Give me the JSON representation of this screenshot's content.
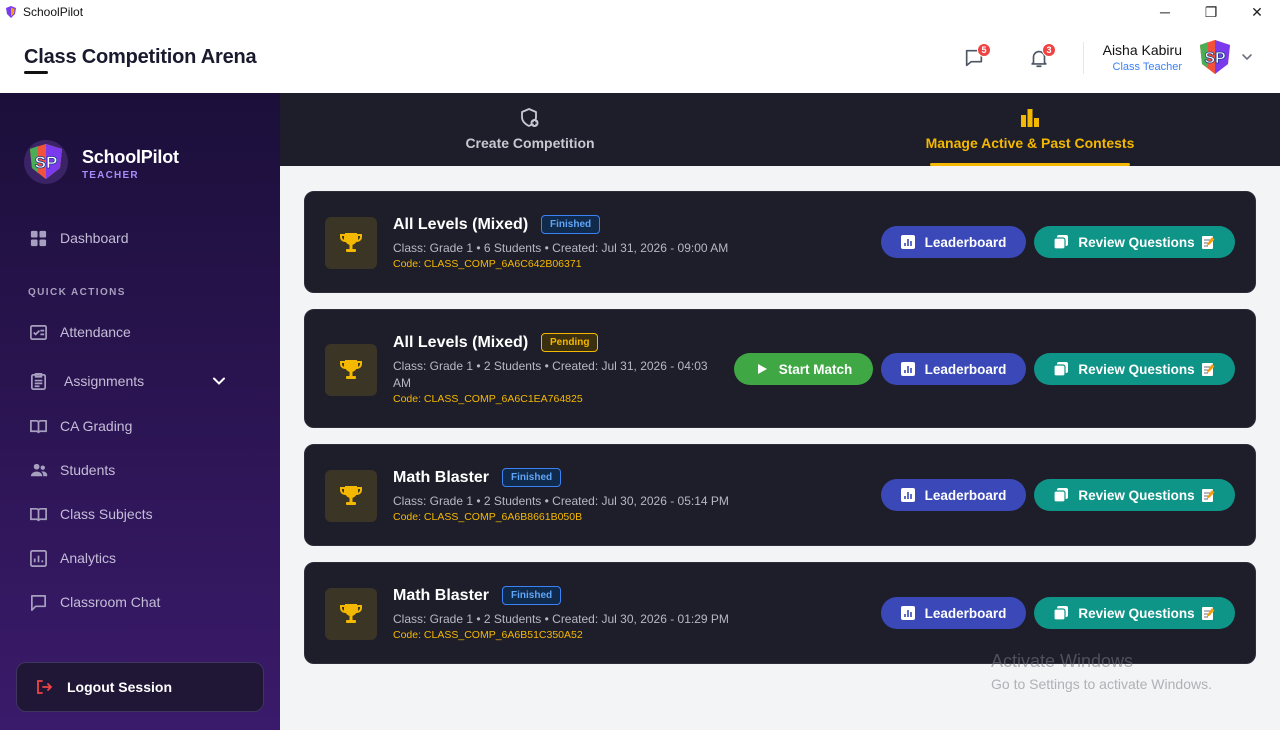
{
  "window": {
    "app_name": "SchoolPilot",
    "controls": [
      "─",
      "❐",
      "✕"
    ]
  },
  "header": {
    "title": "Class Competition Arena",
    "messages_count": "5",
    "notifications_count": "3",
    "user_name": "Aisha Kabiru",
    "user_role": "Class Teacher"
  },
  "sidebar": {
    "brand_name": "SchoolPilot",
    "brand_sub": "TEACHER",
    "dashboard": "Dashboard",
    "section_label": "QUICK ACTIONS",
    "items": [
      {
        "label": "Attendance",
        "icon": "attendance-icon"
      },
      {
        "label": "Assignments",
        "icon": "assignments-icon"
      },
      {
        "label": "CA Grading",
        "icon": "book-icon"
      },
      {
        "label": "Students",
        "icon": "students-icon"
      },
      {
        "label": "Class Subjects",
        "icon": "book-icon"
      },
      {
        "label": "Analytics",
        "icon": "analytics-icon"
      },
      {
        "label": "Classroom Chat",
        "icon": "chat-icon"
      }
    ],
    "logout": "Logout Session"
  },
  "tabs": {
    "create": "Create Competition",
    "manage": "Manage Active & Past Contests"
  },
  "actions": {
    "leaderboard": "Leaderboard",
    "review": "Review Questions",
    "start": "Start Match"
  },
  "contests": [
    {
      "title": "All Levels (Mixed)",
      "status": "Finished",
      "meta": "Class: Grade 1  • 6 Students • Created: Jul 31, 2026 - 09:00 AM",
      "code": "Code: CLASS_COMP_6A6C642B06371"
    },
    {
      "title": "All Levels (Mixed)",
      "status": "Pending",
      "meta": "Class: Grade 1  • 2 Students • Created: Jul 31, 2026 - 04:03 AM",
      "code": "Code: CLASS_COMP_6A6C1EA764825"
    },
    {
      "title": "Math Blaster",
      "status": "Finished",
      "meta": "Class: Grade 1  • 2 Students • Created: Jul 30, 2026 - 05:14 PM",
      "code": "Code: CLASS_COMP_6A6B8661B050B"
    },
    {
      "title": "Math Blaster",
      "status": "Finished",
      "meta": "Class: Grade 1  • 2 Students • Created: Jul 30, 2026 - 01:29 PM",
      "code": "Code: CLASS_COMP_6A6B51C350A52"
    }
  ],
  "watermark": {
    "line1": "Activate Windows",
    "line2": "Go to Settings to activate Windows."
  },
  "colors": {
    "accent": "#f5b800",
    "leaderboard": "#3a48b8",
    "review": "#0f9488",
    "start": "#3fa845",
    "card": "#1e1e2a"
  }
}
